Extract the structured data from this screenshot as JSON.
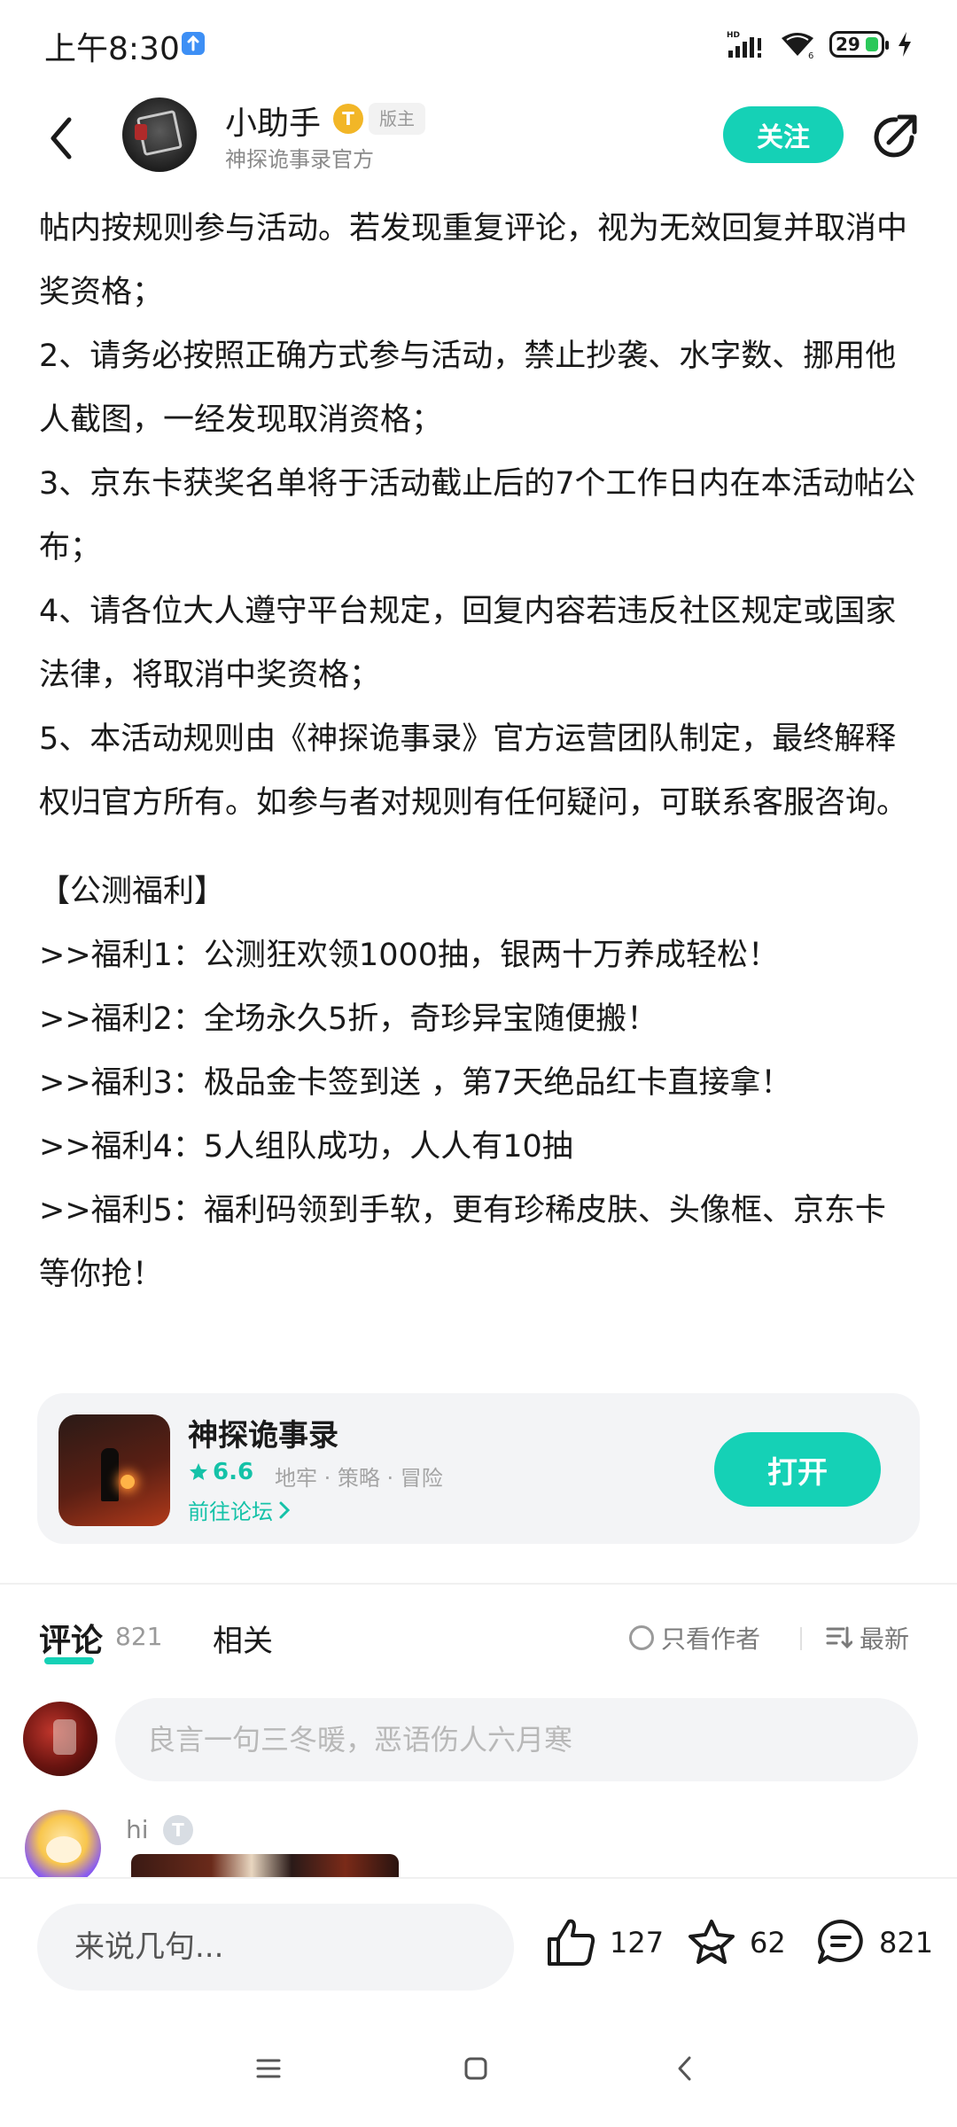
{
  "status_bar": {
    "time": "上午8:30",
    "battery": "29"
  },
  "header": {
    "author_name": "小助手",
    "author_level_badge": "T",
    "moderator_badge": "版主",
    "author_subtitle": "神探诡事录官方",
    "follow_label": "关注"
  },
  "article": {
    "paragraphs": [
      "帖内按规则参与活动。若发现重复评论，视为无效回复并取消中奖资格；",
      "2、请务必按照正确方式参与活动，禁止抄袭、水字数、挪用他人截图，一经发现取消资格；",
      "3、京东卡获奖名单将于活动截止后的7个工作日内在本活动帖公布；",
      "4、请各位大人遵守平台规定，回复内容若违反社区规定或国家法律，将取消中奖资格；",
      "5、本活动规则由《神探诡事录》官方运营团队制定，最终解释权归官方所有。如参与者对规则有任何疑问，可联系客服咨询。"
    ],
    "section_title": "【公测福利】",
    "benefits": [
      ">>福利1：公测狂欢领1000抽，银两十万养成轻松！",
      ">>福利2：全场永久5折，奇珍异宝随便搬！",
      ">>福利3：极品金卡签到送 ，第7天绝品红卡直接拿！",
      ">>福利4：5人组队成功，人人有10抽",
      ">>福利5：福利码领到手软，更有珍稀皮肤、头像框、京东卡等你抢！"
    ]
  },
  "game_card": {
    "name": "神探诡事录",
    "rating": "6.6",
    "tags": "地牢 · 策略 · 冒险",
    "forum_link": "前往论坛",
    "open_label": "打开"
  },
  "comments_bar": {
    "tab_comments": "评论",
    "comment_count": "821",
    "tab_related": "相关",
    "only_author": "只看作者",
    "sort_label": "最新"
  },
  "comment_input": {
    "placeholder": "良言一句三冬暖，恶语伤人六月寒"
  },
  "first_comment": {
    "user_name": "hi",
    "badge": "T"
  },
  "bottom_bar": {
    "input_placeholder": "来说几句...",
    "likes": "127",
    "favorites": "62",
    "comments": "821"
  },
  "colors": {
    "accent": "#15d1b6",
    "badge_gold": "#f2b627"
  }
}
